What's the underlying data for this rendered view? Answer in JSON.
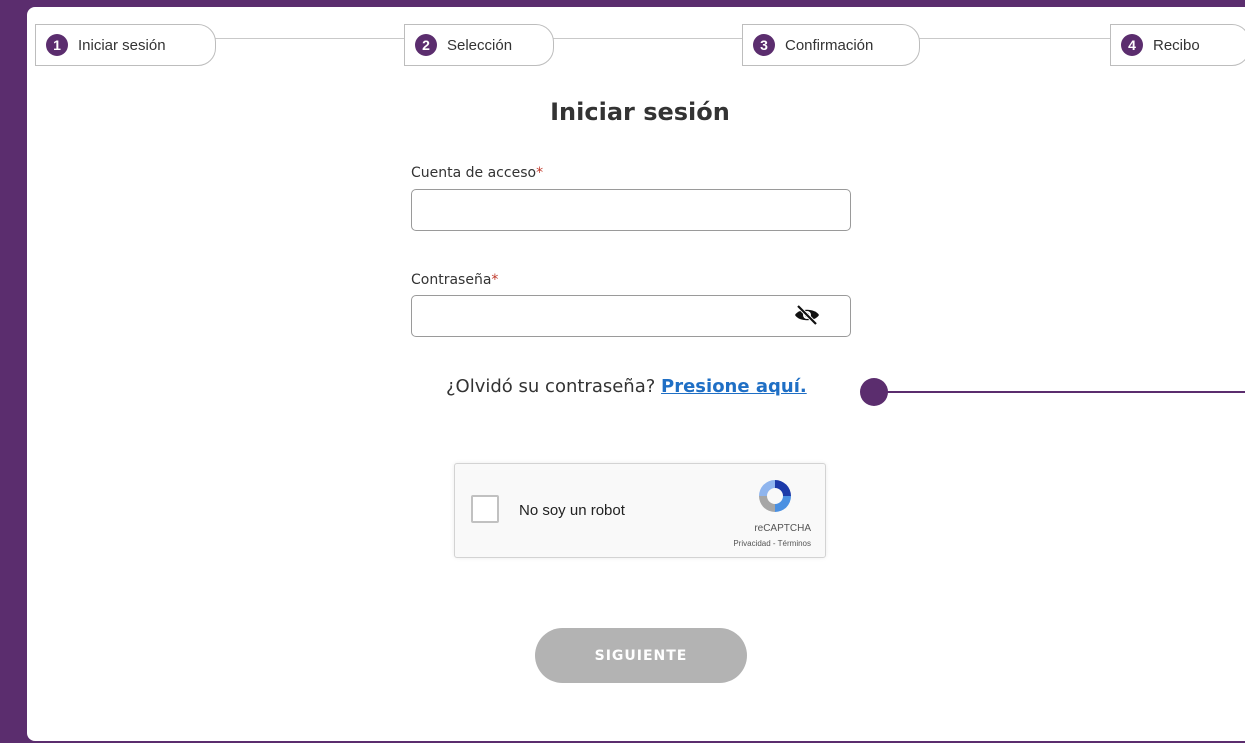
{
  "steps": [
    {
      "num": "1",
      "label": "Iniciar sesión"
    },
    {
      "num": "2",
      "label": "Selección"
    },
    {
      "num": "3",
      "label": "Confirmación"
    },
    {
      "num": "4",
      "label": "Recibo"
    }
  ],
  "login": {
    "title": "Iniciar sesión",
    "account_label": "Cuenta de acceso",
    "password_label": "Contraseña",
    "required_mark": "*",
    "account_value": "",
    "password_value": "",
    "forgot_text": "¿Olvidó su contraseña?",
    "forgot_link": "Presione aquí.",
    "next_button": "SIGUIENTE"
  },
  "captcha": {
    "label": "No soy un robot",
    "brand": "reCAPTCHA",
    "links": "Privacidad - Términos"
  },
  "colors": {
    "accent": "#5b2d6e",
    "link": "#1f6fc5",
    "button_disabled": "#b3b3b3"
  }
}
